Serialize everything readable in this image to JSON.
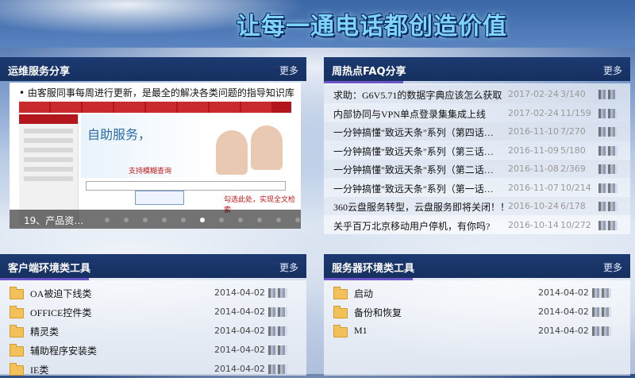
{
  "banner": {
    "title": "让每一通电话都创造价值"
  },
  "ops": {
    "title": "运维服务分享",
    "more": "更多",
    "slide": {
      "caption": "• 由客服同事每周进行更新，是最全的解决各类问题的指导知识库集",
      "headline": "自助服务，",
      "hint": "支持模糊查询",
      "hint2": "勾选此处，实现全文检索",
      "label": "19、产品资…",
      "dots": 11,
      "active_dot": 5
    }
  },
  "faq": {
    "title": "周热点FAQ分享",
    "more": "更多",
    "rows": [
      {
        "title": "求助：G6V5.71的数据字典应该怎么获取",
        "date": "2017-02-24",
        "count": "3/140"
      },
      {
        "title": "内部协同与VPN单点登录集集成上线",
        "date": "2017-02-24",
        "count": "11/159"
      },
      {
        "title": "一分钟搞懂\"致远天条\"系列（第四话…",
        "date": "2016-11-10",
        "count": "7/270"
      },
      {
        "title": "一分钟搞懂\"致远天条\"系列（第三话…",
        "date": "2016-11-09",
        "count": "5/180"
      },
      {
        "title": "一分钟搞懂\"致远天条\"系列（第二话…",
        "date": "2016-11-08",
        "count": "2/369"
      },
      {
        "title": "一分钟搞懂\"致远天条\"系列（第一话…",
        "date": "2016-11-07",
        "count": "10/214"
      },
      {
        "title": "360云盘服务转型，云盘服务即将关闭！！",
        "date": "2016-10-24",
        "count": "6/178"
      },
      {
        "title": "关乎百万北京移动用户停机，有你吗?",
        "date": "2016-10-14",
        "count": "10/272"
      }
    ]
  },
  "client_tools": {
    "title": "客户端环境类工具",
    "more": "更多",
    "rows": [
      {
        "name": "OA被迫下线类",
        "date": "2014-04-02"
      },
      {
        "name": "OFFICE控件类",
        "date": "2014-04-02"
      },
      {
        "name": "精灵类",
        "date": "2014-04-02"
      },
      {
        "name": "辅助程序安装类",
        "date": "2014-04-02"
      },
      {
        "name": "IE类",
        "date": "2014-04-02"
      }
    ]
  },
  "server_tools": {
    "title": "服务器环境类工具",
    "more": "更多",
    "rows": [
      {
        "name": "启动",
        "date": "2014-04-02"
      },
      {
        "name": "备份和恢复",
        "date": "2014-04-02"
      },
      {
        "name": "M1",
        "date": "2014-04-02"
      }
    ]
  },
  "colors": {
    "header_bg": "#1d3a72",
    "accent": "#6c54c9",
    "banner_text": "#7fd4ff"
  }
}
